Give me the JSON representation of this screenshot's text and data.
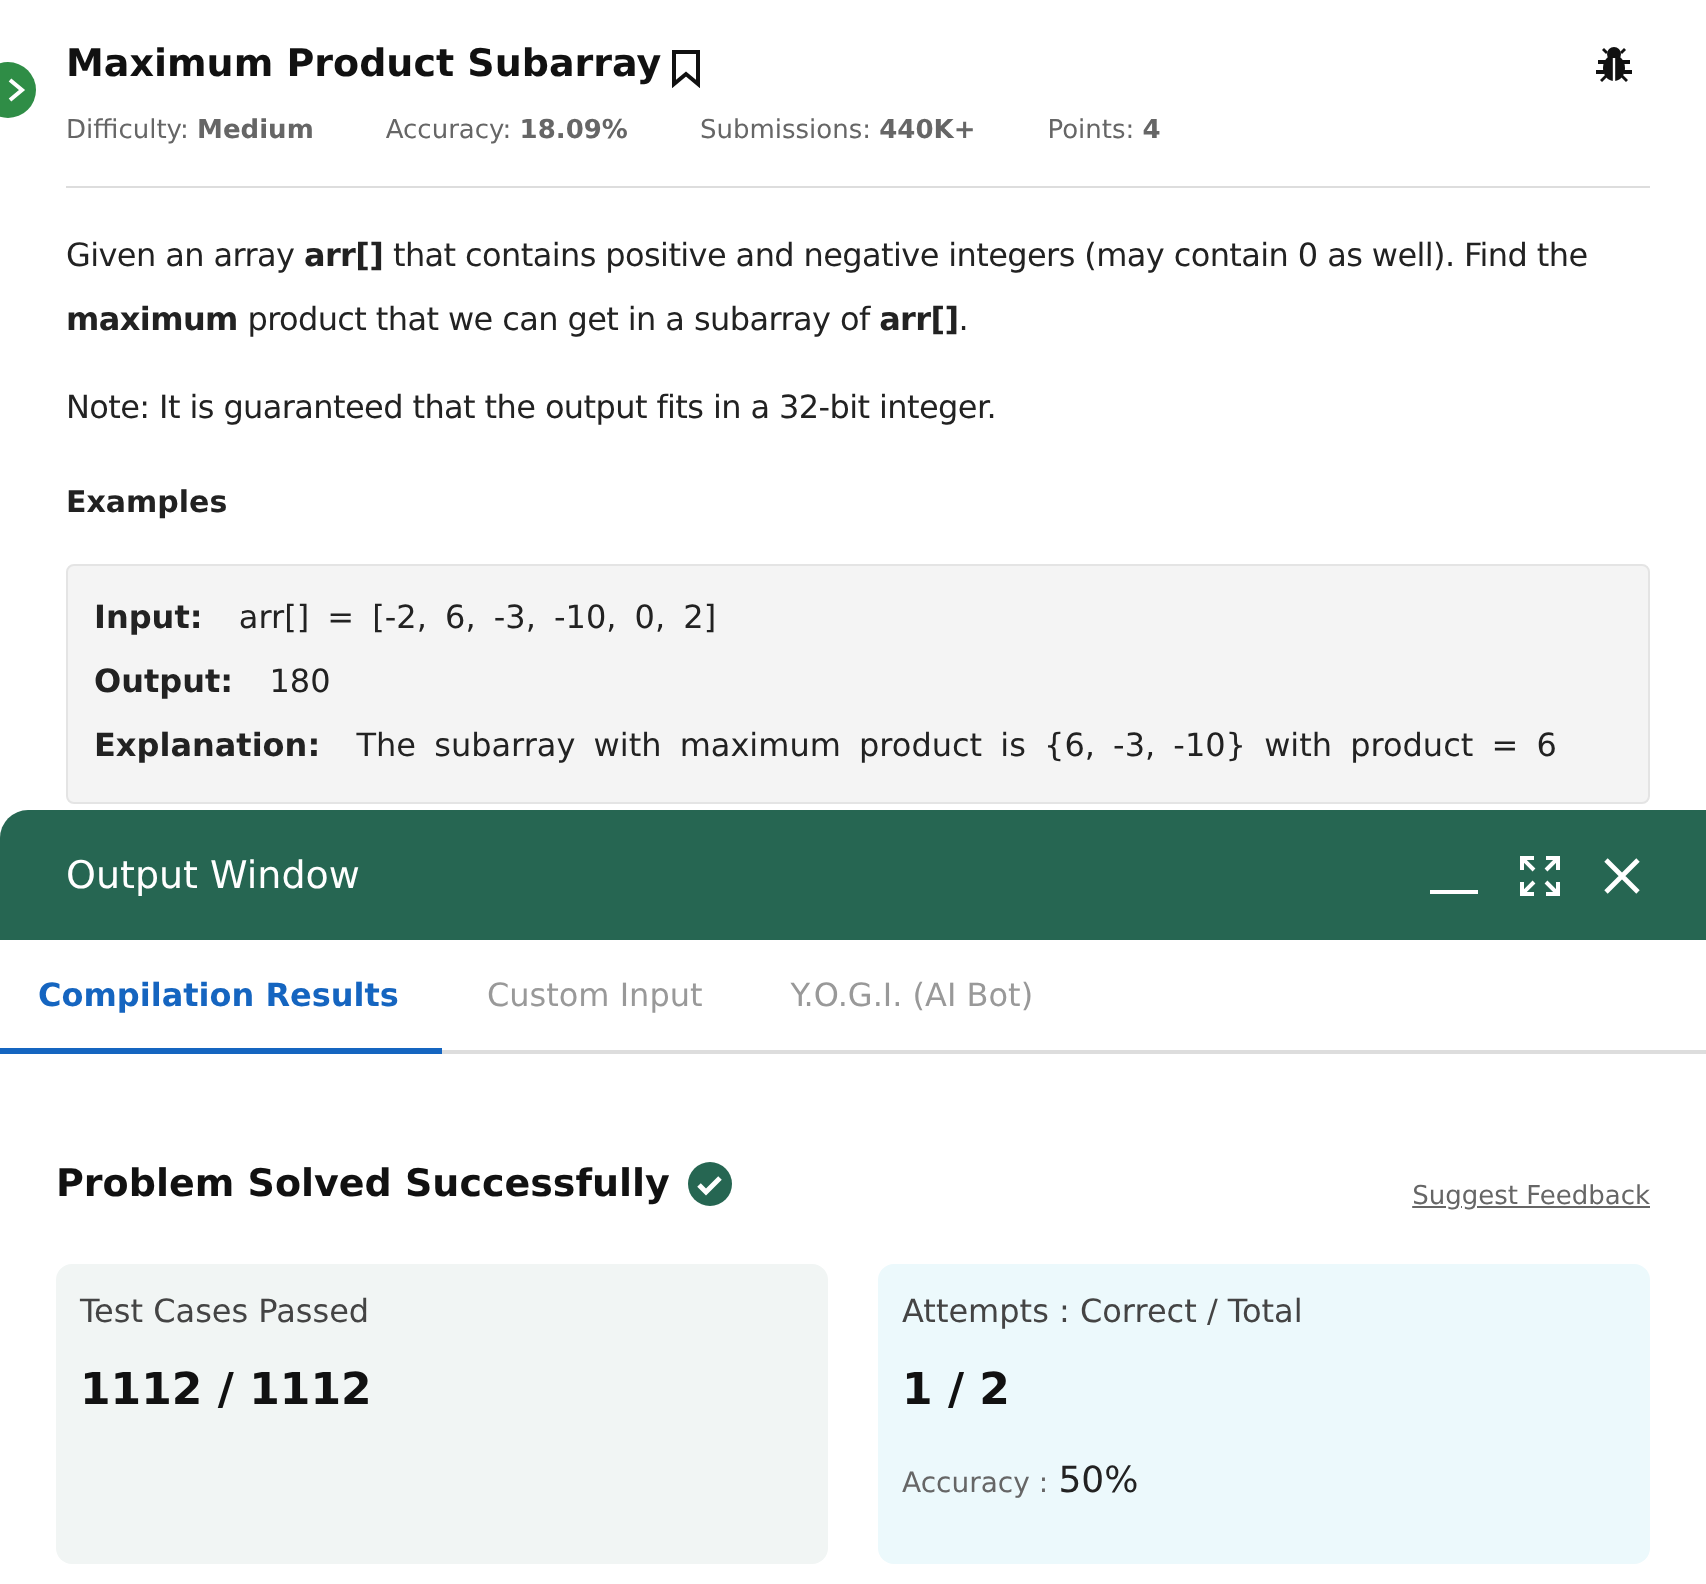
{
  "problem": {
    "title": "Maximum Product Subarray",
    "meta": [
      {
        "label": "Difficulty:",
        "value": "Medium"
      },
      {
        "label": "Accuracy:",
        "value": "18.09%"
      },
      {
        "label": "Submissions:",
        "value": "440K+"
      },
      {
        "label": "Points:",
        "value": "4"
      }
    ],
    "paragraphs": [
      "Given an array **arr[]** that contains positive and negative integers (may contain 0 as well). Find the **maximum** product that we can get in a subarray of **arr[]**.",
      "Note: It is guaranteed that the output fits in a 32-bit integer."
    ],
    "examples_heading": "Examples",
    "example": [
      {
        "label": "Input:",
        "value": "arr[] = [-2, 6, -3, -10, 0, 2]"
      },
      {
        "label": "Output:",
        "value": "180"
      },
      {
        "label": "Explanation:",
        "value": "The subarray with maximum product is {6, -3, -10} with product = 6"
      }
    ]
  },
  "output_window": {
    "title": "Output Window",
    "tabs": [
      {
        "label": "Compilation Results",
        "selected": true
      },
      {
        "label": "Custom Input",
        "selected": false
      },
      {
        "label": "Y.O.G.I. (AI Bot)",
        "selected": false
      }
    ],
    "result": "Problem Solved Successfully",
    "feedback_link": "Suggest Feedback",
    "cards": [
      {
        "title": "Test Cases Passed",
        "value": "1112 / 1112",
        "kind": "plain"
      },
      {
        "title": "Attempts : Correct / Total",
        "value": "1 / 2",
        "kind": "accuracy",
        "accuracy_label": "Accuracy :",
        "accuracy_value": "50%"
      }
    ]
  }
}
